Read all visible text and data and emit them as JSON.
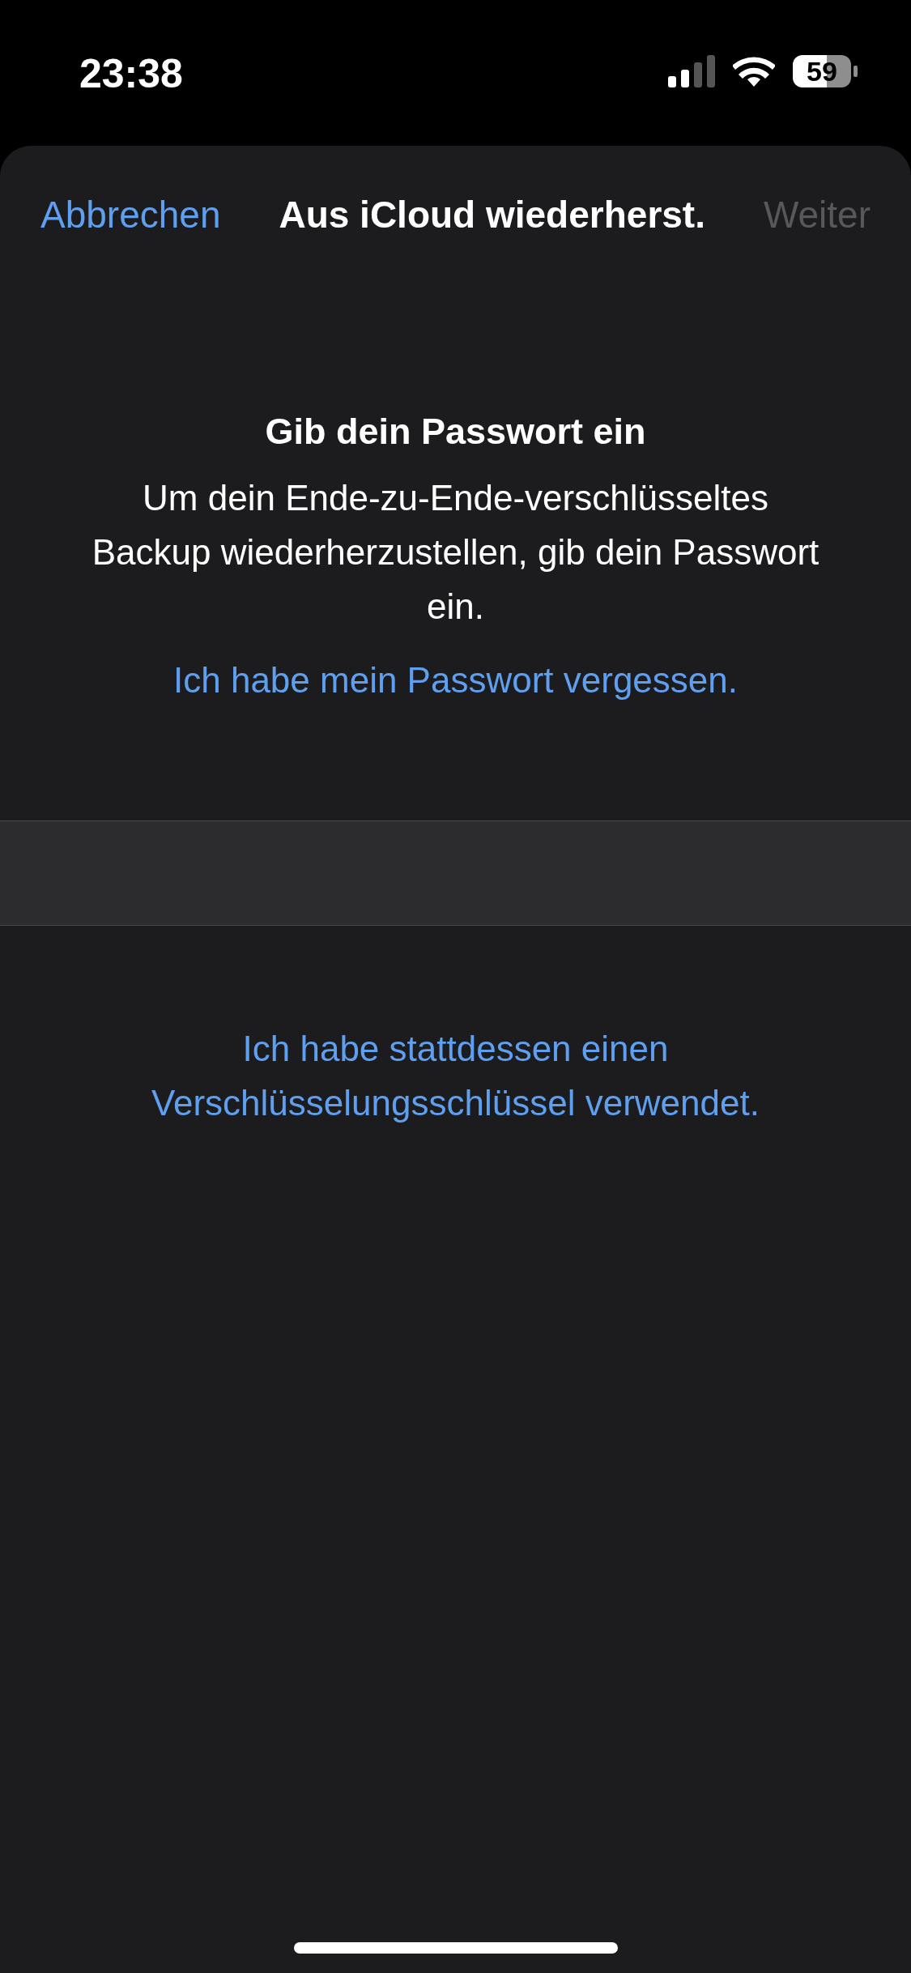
{
  "status_bar": {
    "time": "23:38",
    "battery": "59"
  },
  "nav": {
    "cancel": "Abbrechen",
    "title": "Aus iCloud wiederherst.",
    "next": {
      "label": "Weiter",
      "disabled": true
    }
  },
  "prompt": {
    "title": "Gib dein Passwort ein",
    "message": "Um dein Ende-zu-Ende-verschlüsseltes Backup wiederherzustellen, gib dein Passwort ein.",
    "forgot_link": "Ich habe mein Passwort vergessen."
  },
  "alternative_link": "Ich habe stattdessen einen Verschlüsselungsschlüssel verwendet."
}
